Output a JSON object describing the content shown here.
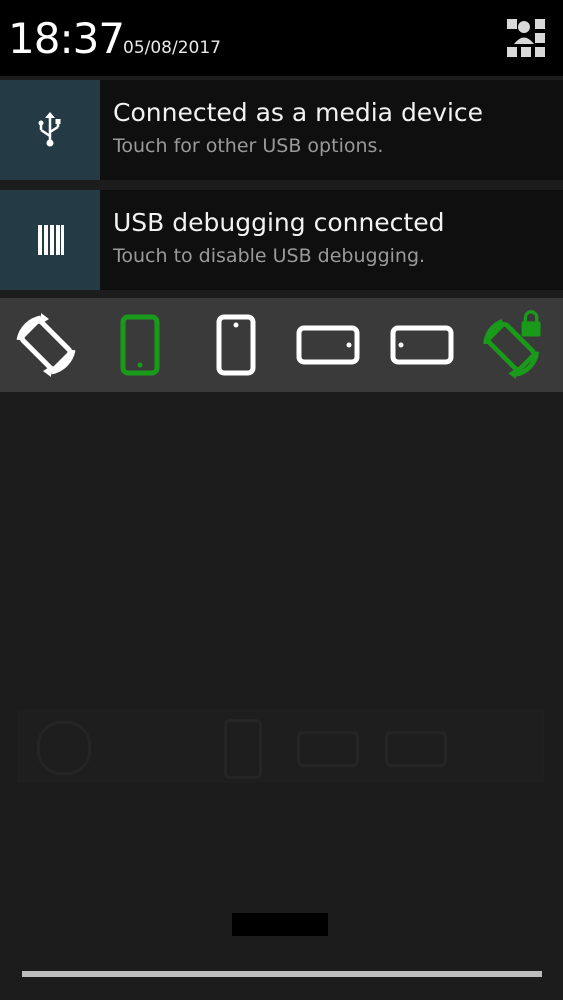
{
  "status": {
    "time": "18:37",
    "date": "05/08/2017",
    "user_icon": "user-switch-icon"
  },
  "notifications": [
    {
      "icon": "usb-icon",
      "title": "Connected as a media device",
      "subtitle": "Touch for other USB options."
    },
    {
      "icon": "usb-debugging-icon",
      "title": "USB debugging connected",
      "subtitle": "Touch to disable USB debugging."
    }
  ],
  "rotation_options": [
    {
      "icon": "auto-rotate-icon",
      "active": false
    },
    {
      "icon": "portrait-icon",
      "active": true,
      "color": "#1a9a1a"
    },
    {
      "icon": "reverse-portrait-icon",
      "active": false
    },
    {
      "icon": "landscape-icon",
      "active": false
    },
    {
      "icon": "reverse-landscape-icon",
      "active": false
    },
    {
      "icon": "rotation-lock-icon",
      "active": true,
      "color": "#1a9a1a"
    }
  ]
}
